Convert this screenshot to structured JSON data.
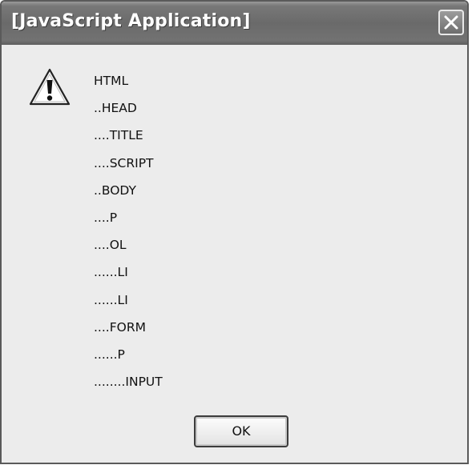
{
  "window": {
    "title": "[JavaScript Application]",
    "close_icon": "close-icon",
    "warning_icon": "warning-icon"
  },
  "message": {
    "lines": [
      "HTML",
      "..HEAD",
      "....TITLE",
      "....SCRIPT",
      "..BODY",
      "....P",
      "....OL",
      "......LI",
      "......LI",
      "....FORM",
      "......P",
      "........INPUT"
    ]
  },
  "buttons": {
    "ok_label": "OK"
  },
  "colors": {
    "titlebar": "#6e6e6e",
    "dialog_background": "#ececec",
    "title_text": "#ffffff"
  }
}
